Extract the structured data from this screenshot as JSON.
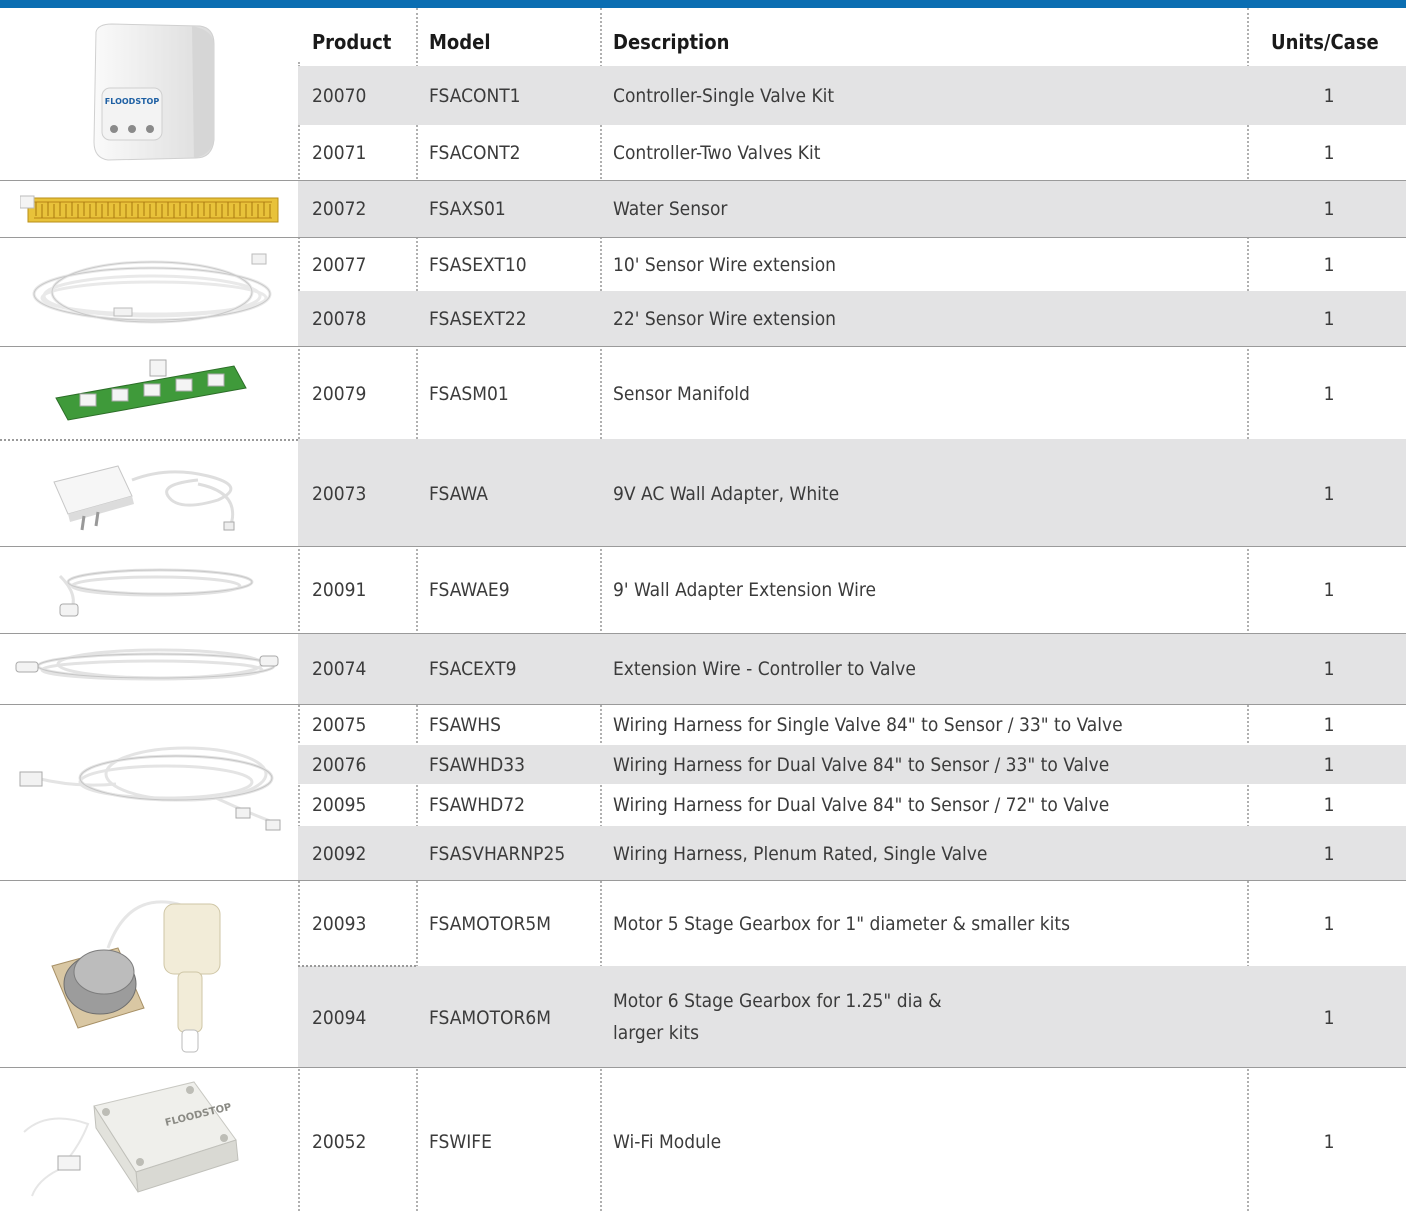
{
  "header": {
    "product": "Product",
    "model": "Model",
    "description": "Description",
    "units": "Units/Case"
  },
  "rows": [
    {
      "product": "20070",
      "model": "FSACONT1",
      "description": "Controller-Single Valve Kit",
      "units": "1"
    },
    {
      "product": "20071",
      "model": "FSACONT2",
      "description": "Controller-Two Valves Kit",
      "units": "1"
    },
    {
      "product": "20072",
      "model": "FSAXS01",
      "description": "Water Sensor",
      "units": "1"
    },
    {
      "product": "20077",
      "model": "FSASEXT10",
      "description": "10' Sensor Wire extension",
      "units": "1"
    },
    {
      "product": "20078",
      "model": "FSASEXT22",
      "description": "22' Sensor Wire extension",
      "units": "1"
    },
    {
      "product": "20079",
      "model": "FSASM01",
      "description": "Sensor Manifold",
      "units": "1"
    },
    {
      "product": "20073",
      "model": "FSAWA",
      "description": "9V AC Wall Adapter, White",
      "units": "1"
    },
    {
      "product": "20091",
      "model": "FSAWAE9",
      "description": "9' Wall Adapter Extension Wire",
      "units": "1"
    },
    {
      "product": "20074",
      "model": "FSACEXT9",
      "description": "Extension Wire - Controller to Valve",
      "units": "1"
    },
    {
      "product": "20075",
      "model": "FSAWHS",
      "description": "Wiring Harness for Single Valve 84\" to Sensor / 33\" to Valve",
      "units": "1"
    },
    {
      "product": "20076",
      "model": "FSAWHD33",
      "description": "Wiring Harness for Dual Valve 84\" to Sensor / 33\" to Valve",
      "units": "1"
    },
    {
      "product": "20095",
      "model": "FSAWHD72",
      "description": "Wiring Harness for Dual Valve 84\" to Sensor / 72\" to Valve",
      "units": "1"
    },
    {
      "product": "20092",
      "model": "FSASVHARNP25",
      "description": "Wiring Harness, Plenum Rated, Single Valve",
      "units": "1"
    },
    {
      "product": "20093",
      "model": "FSAMOTOR5M",
      "description": "Motor 5 Stage Gearbox for 1\" diameter & smaller kits",
      "units": "1"
    },
    {
      "product": "20094",
      "model": "FSAMOTOR6M",
      "description_line1": "Motor 6 Stage Gearbox for 1.25\" dia &",
      "description_line2": "larger kits",
      "units": "1"
    },
    {
      "product": "20052",
      "model": "FSWIFE",
      "description": "Wi-Fi Module",
      "units": "1"
    }
  ],
  "images": {
    "controller_brand": "FLOODSTOP",
    "wifi_brand": "FLOODSTOP"
  },
  "colors": {
    "top_bar": "#0b6eb2",
    "row_shade": "#e3e3e4",
    "sensor_yellow": "#e8c23a",
    "manifold_green": "#3f9a3a"
  }
}
